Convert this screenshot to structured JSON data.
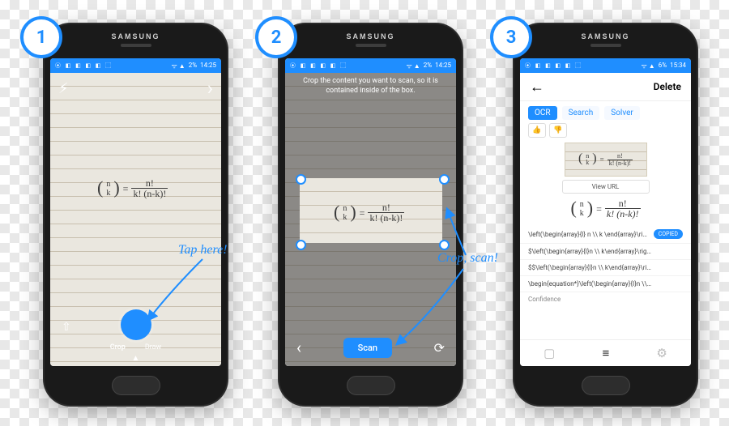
{
  "brand": "SAMSUNG",
  "status": {
    "icons": "⦿ ◧ ◧ ◧ ◧ ⬚",
    "right_icons": "ᯤ ▲",
    "battery_1_2": "2%",
    "battery_3": "6%",
    "time_1_2": "14:25",
    "time_3": "15:34"
  },
  "steps": {
    "s1": {
      "num": "1",
      "annotation": "Tap here!"
    },
    "s2": {
      "num": "2",
      "annotation": "Crop, scan!"
    },
    "s3": {
      "num": "3"
    }
  },
  "formula": {
    "binom_top": "n",
    "binom_bot": "k",
    "eq": "=",
    "num": "n!",
    "den": "k! (n-k)!"
  },
  "phone1": {
    "mode_crop": "Crop",
    "mode_draw": "Draw"
  },
  "phone2": {
    "crop_hint": "Crop the content you want to scan, so it is contained inside of the box.",
    "scan": "Scan"
  },
  "phone3": {
    "delete": "Delete",
    "tab_ocr": "OCR",
    "tab_search": "Search",
    "tab_solver": "Solver",
    "view_url": "View URL",
    "copied": "COPIED",
    "latex1": "\\left(\\begin{array}{l} n \\\\ k \\end{array}\\rig…",
    "latex2": "$\\left(\\begin{array}{l}n \\\\ k\\end{array}\\rig…",
    "latex3": "$$\\left(\\begin{array}{l}n \\\\ k\\end{array}\\ri…",
    "latex4": "\\begin{equation*}\\left(\\begin{array}{l}n \\\\…",
    "confidence": "Confidence"
  }
}
